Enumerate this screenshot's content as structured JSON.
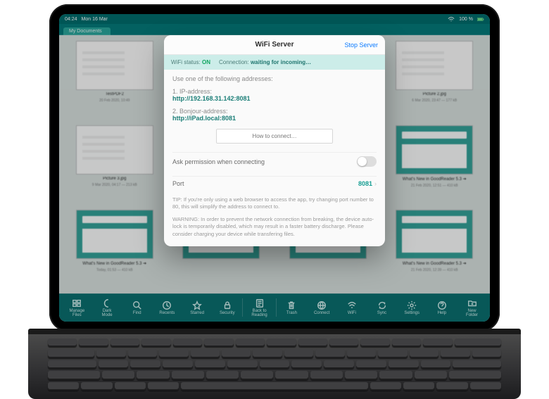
{
  "statusbar": {
    "time": "04:24",
    "date": "Mon 16 Mar",
    "battery": "100 %"
  },
  "tab": {
    "label": "My Documents"
  },
  "docs": [
    {
      "title": "TestPDF2",
      "meta": "20 Feb 2020, 10:49",
      "kind": "pdf"
    },
    {
      "title": "",
      "meta": "",
      "kind": "dark"
    },
    {
      "title": "",
      "meta": "",
      "kind": "text"
    },
    {
      "title": "Picture 2.jpg",
      "meta": "6 Mar 2020, 23:47 — 177 kB",
      "kind": "img"
    },
    {
      "title": "Picture 3.jpg",
      "meta": "9 Mar 2020, 04:17 — 213 kB",
      "kind": "img"
    },
    {
      "title": "",
      "meta": "",
      "kind": "gr"
    },
    {
      "title": "",
      "meta": "",
      "kind": "gr"
    },
    {
      "title": "What's New in GoodReader 5.3 ➔",
      "meta": "21 Feb 2020, 12:51 — 410 kB",
      "kind": "gr"
    },
    {
      "title": "What's New in GoodReader 5.3 ➔",
      "meta": "Today, 01:53 — 410 kB",
      "kind": "gr"
    },
    {
      "title": "",
      "meta": "",
      "kind": "gr"
    },
    {
      "title": "",
      "meta": "",
      "kind": "gr"
    },
    {
      "title": "What's New in GoodReader 5.3 ➔",
      "meta": "21 Feb 2020, 12:39 — 410 kB",
      "kind": "gr"
    }
  ],
  "modal": {
    "title": "WiFi Server",
    "stop": "Stop Server",
    "status": {
      "wifi_label": "WiFi status:",
      "wifi_value": "ON",
      "conn_label": "Connection:",
      "conn_value": "waiting for incoming…"
    },
    "intro": "Use one of the following addresses:",
    "ip_label": "1. IP-address:",
    "ip_link": "http://192.168.31.142:8081",
    "bonjour_label": "2. Bonjour-address:",
    "bonjour_link": "http://iPad.local:8081",
    "how": "How to connect…",
    "ask_label": "Ask permission when connecting",
    "port_label": "Port",
    "port_value": "8081",
    "tip": "TIP: If you're only using a web browser to access the app, try changing port number to 80, this will simplify the address to connect to.",
    "warn": "WARNING: In order to prevent the network connection from breaking, the device auto-lock is temporarily disabled, which may result in a faster battery discharge. Please consider charging your device while transfering files."
  },
  "toolbar": [
    {
      "id": "manage-files",
      "label": "Manage\nFiles"
    },
    {
      "id": "dark-mode",
      "label": "Dark\nMode"
    },
    {
      "id": "find",
      "label": "Find"
    },
    {
      "id": "recents",
      "label": "Recents"
    },
    {
      "id": "starred",
      "label": "Starred"
    },
    {
      "id": "security",
      "label": "Security"
    },
    {
      "id": "back-reading",
      "label": "Back to\nReading"
    },
    {
      "id": "trash",
      "label": "Trash"
    },
    {
      "id": "connect",
      "label": "Connect"
    },
    {
      "id": "wifi",
      "label": "WiFi"
    },
    {
      "id": "sync",
      "label": "Sync"
    },
    {
      "id": "settings",
      "label": "Settings"
    },
    {
      "id": "help",
      "label": "Help"
    },
    {
      "id": "new-folder",
      "label": "New\nFolder"
    }
  ]
}
